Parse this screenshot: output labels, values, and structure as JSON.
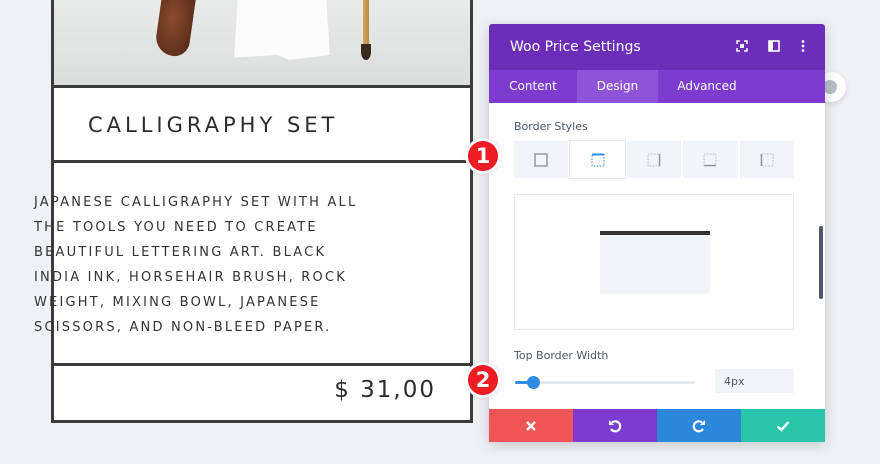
{
  "product": {
    "title": "CALLIGRAPHY SET",
    "description_lines": [
      "JAPANESE CALLIGRAPHY SET WITH ALL",
      "THE TOOLS YOU NEED TO CREATE",
      "BEAUTIFUL LETTERING ART.  BLACK",
      "INDIA INK, HORSEHAIR BRUSH, ROCK",
      "WEIGHT, MIXING BOWL, JAPANESE",
      "SCISSORS, AND NON-BLEED PAPER."
    ],
    "price": "$ 31,00"
  },
  "markers": [
    "1",
    "2"
  ],
  "panel": {
    "title": "Woo Price Settings",
    "header_icons": [
      "expand-icon",
      "split-view-icon",
      "more-vertical-icon"
    ],
    "tabs": [
      {
        "label": "Content",
        "active": false
      },
      {
        "label": "Design",
        "active": true
      },
      {
        "label": "Advanced",
        "active": false
      }
    ],
    "border_styles_label": "Border Styles",
    "border_options": [
      "all-sides",
      "top",
      "right",
      "bottom",
      "left"
    ],
    "border_selected": "top",
    "top_border_width_label": "Top Border Width",
    "top_border_width_value": "4px",
    "slider_fraction": 0.1
  },
  "footer_buttons": [
    {
      "name": "cancel",
      "icon": "close-icon",
      "color": "#ef5555"
    },
    {
      "name": "undo",
      "icon": "undo-icon",
      "color": "#7e3bd0"
    },
    {
      "name": "redo",
      "icon": "redo-icon",
      "color": "#2b87da"
    },
    {
      "name": "save",
      "icon": "check-icon",
      "color": "#29c4a9"
    }
  ],
  "colors": {
    "header": "#6c2eb9",
    "tabs": "#7d3bcf",
    "accent_blue": "#2c8de3",
    "marker_red": "#ee1c23"
  }
}
